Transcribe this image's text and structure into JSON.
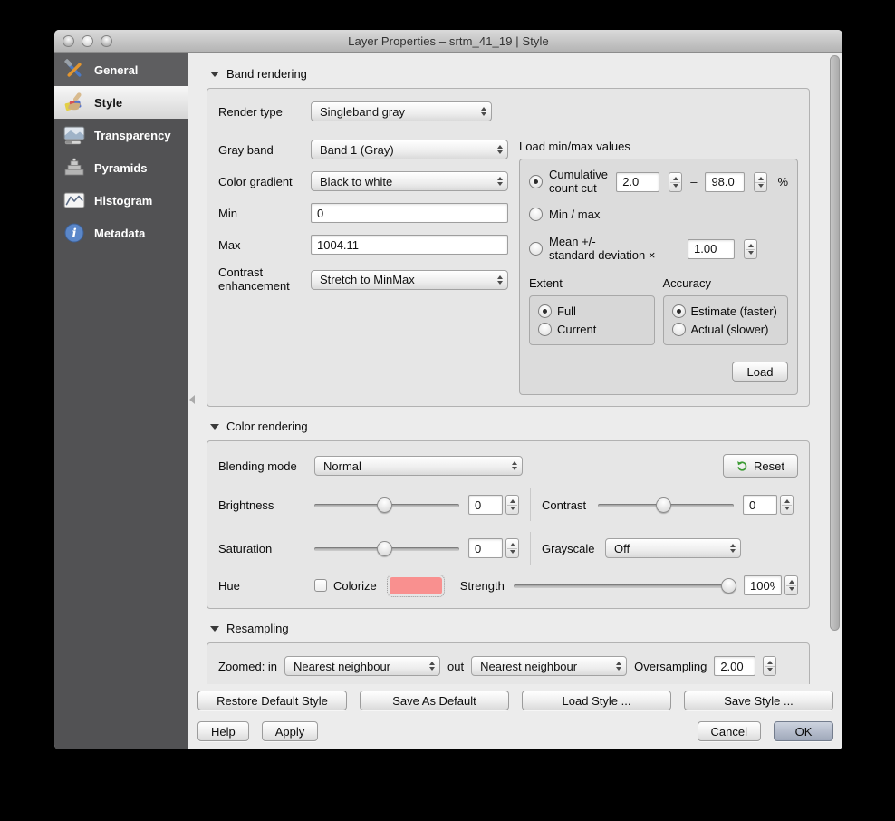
{
  "window": {
    "title": "Layer Properties – srtm_41_19 | Style"
  },
  "sidebar": {
    "items": [
      {
        "label": "General",
        "icon": "tools-icon"
      },
      {
        "label": "Style",
        "icon": "paintbrush-icon",
        "selected": true
      },
      {
        "label": "Transparency",
        "icon": "transparency-icon"
      },
      {
        "label": "Pyramids",
        "icon": "pyramids-icon"
      },
      {
        "label": "Histogram",
        "icon": "histogram-icon"
      },
      {
        "label": "Metadata",
        "icon": "info-icon"
      }
    ]
  },
  "band_rendering": {
    "title": "Band rendering",
    "render_type_label": "Render type",
    "render_type_value": "Singleband gray",
    "gray_band_label": "Gray band",
    "gray_band_value": "Band 1 (Gray)",
    "color_gradient_label": "Color gradient",
    "color_gradient_value": "Black to white",
    "min_label": "Min",
    "min_value": "0",
    "max_label": "Max",
    "max_value": "1004.11",
    "contrast_label_line1": "Contrast",
    "contrast_label_line2": "enhancement",
    "contrast_value": "Stretch to MinMax",
    "load_minmax": {
      "title": "Load min/max values",
      "cumulative_line1": "Cumulative",
      "cumulative_line2": "count cut",
      "cumulative_from": "2.0",
      "cumulative_dash": "–",
      "cumulative_to": "98.0",
      "cumulative_unit": "%",
      "minmax_label": "Min / max",
      "mean_line1": "Mean +/-",
      "mean_line2": "standard deviation ×",
      "mean_value": "1.00",
      "extent_title": "Extent",
      "extent_options": [
        "Full",
        "Current"
      ],
      "extent_selected": "Full",
      "accuracy_title": "Accuracy",
      "accuracy_options": [
        "Estimate (faster)",
        "Actual (slower)"
      ],
      "accuracy_selected": "Estimate (faster)",
      "load_button": "Load"
    }
  },
  "color_rendering": {
    "title": "Color rendering",
    "blending_label": "Blending mode",
    "blending_value": "Normal",
    "reset_label": "Reset",
    "brightness_label": "Brightness",
    "brightness_value": "0",
    "contrast_label": "Contrast",
    "contrast_value": "0",
    "saturation_label": "Saturation",
    "saturation_value": "0",
    "grayscale_label": "Grayscale",
    "grayscale_value": "Off",
    "hue_label": "Hue",
    "colorize_label": "Colorize",
    "colorize_checked": false,
    "swatch_color": "#f9908f",
    "strength_label": "Strength",
    "strength_value": "100%"
  },
  "resampling": {
    "title": "Resampling",
    "zoomed_label": "Zoomed: in",
    "in_value": "Nearest neighbour",
    "out_label": "out",
    "out_value": "Nearest neighbour",
    "oversampling_label": "Oversampling",
    "oversampling_value": "2.00"
  },
  "footer": {
    "style_buttons": [
      "Restore Default Style",
      "Save As Default",
      "Load Style ...",
      "Save Style ..."
    ],
    "help": "Help",
    "apply": "Apply",
    "cancel": "Cancel",
    "ok": "OK"
  },
  "colors": {
    "sidebar_bg": "#525254",
    "window_bg": "#ececec",
    "hue_swatch": "#f9908f",
    "ok_button_top": "#cdd3df",
    "ok_button_bottom": "#9fa8ba"
  }
}
